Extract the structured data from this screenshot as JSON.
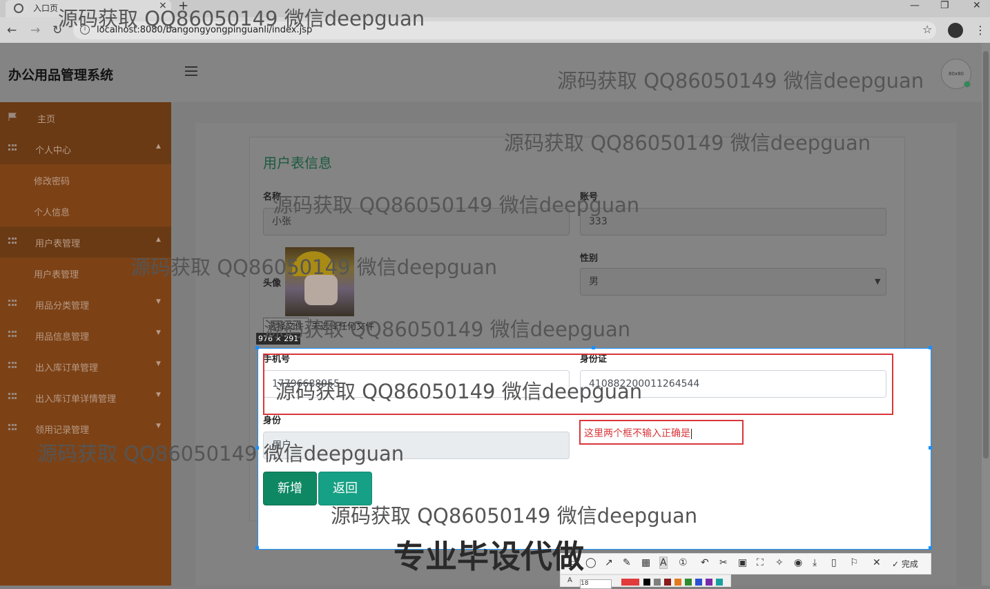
{
  "browser": {
    "tab_title": "入口页",
    "tab_close": "×",
    "new_tab": "+",
    "url": "localhost:8080/bangongyongpinguanli/index.jsp",
    "back": "←",
    "forward": "→",
    "reload": "↻",
    "info": "i",
    "star": "☆",
    "menu": "⋮",
    "minimize": "—",
    "restore": "❐",
    "close": "✕"
  },
  "app": {
    "brand": "办公用品管理系统",
    "avatar_text": "80x80"
  },
  "sidebar": {
    "items": [
      {
        "label": "主页",
        "icon": "flag-icon"
      },
      {
        "label": "个人中心",
        "icon": "grid-icon",
        "caret": "▲"
      },
      {
        "label": "修改密码"
      },
      {
        "label": "个人信息"
      },
      {
        "label": "用户表管理",
        "icon": "grid-icon",
        "caret": "▲"
      },
      {
        "label": "用户表管理"
      },
      {
        "label": "用品分类管理",
        "icon": "grid-icon",
        "caret": "▼"
      },
      {
        "label": "用品信息管理",
        "icon": "grid-icon",
        "caret": "▼"
      },
      {
        "label": "出入库订单管理",
        "icon": "grid-icon",
        "caret": "▼"
      },
      {
        "label": "出入库订单详情管理",
        "icon": "grid-icon",
        "caret": "▼"
      },
      {
        "label": "领用记录管理",
        "icon": "grid-icon",
        "caret": "▼"
      }
    ]
  },
  "form": {
    "title": "用户表信息",
    "name_label": "名称",
    "name_value": "小张",
    "account_label": "账号",
    "account_value": "333",
    "avatar_label": "头像",
    "gender_label": "性别",
    "gender_value": "男",
    "file_button": "选择文件",
    "file_status": "未选择任何文件",
    "phone_label": "手机号",
    "phone_value": "17796688955",
    "idcard_label": "身份证",
    "idcard_value": "410882200011264544",
    "role_label": "身份",
    "role_value": "用户",
    "add_button": "新增",
    "back_button": "返回"
  },
  "screenshot_tool": {
    "size_label": "976 × 291",
    "annotation_text": "这里两个框不输入正确是",
    "done_label": "完成",
    "font_size": "18",
    "colors": [
      "#e23b3b",
      "#000000",
      "#7f7f7f",
      "#8b1a1a",
      "#e37b1d",
      "#2e8b2e",
      "#2a4fd1",
      "#7a2aa8",
      "#18a0a0"
    ]
  },
  "watermarks": {
    "text": "源码获取 QQ86050149 微信deepguan",
    "bottom_text": "专业毕设代做"
  }
}
